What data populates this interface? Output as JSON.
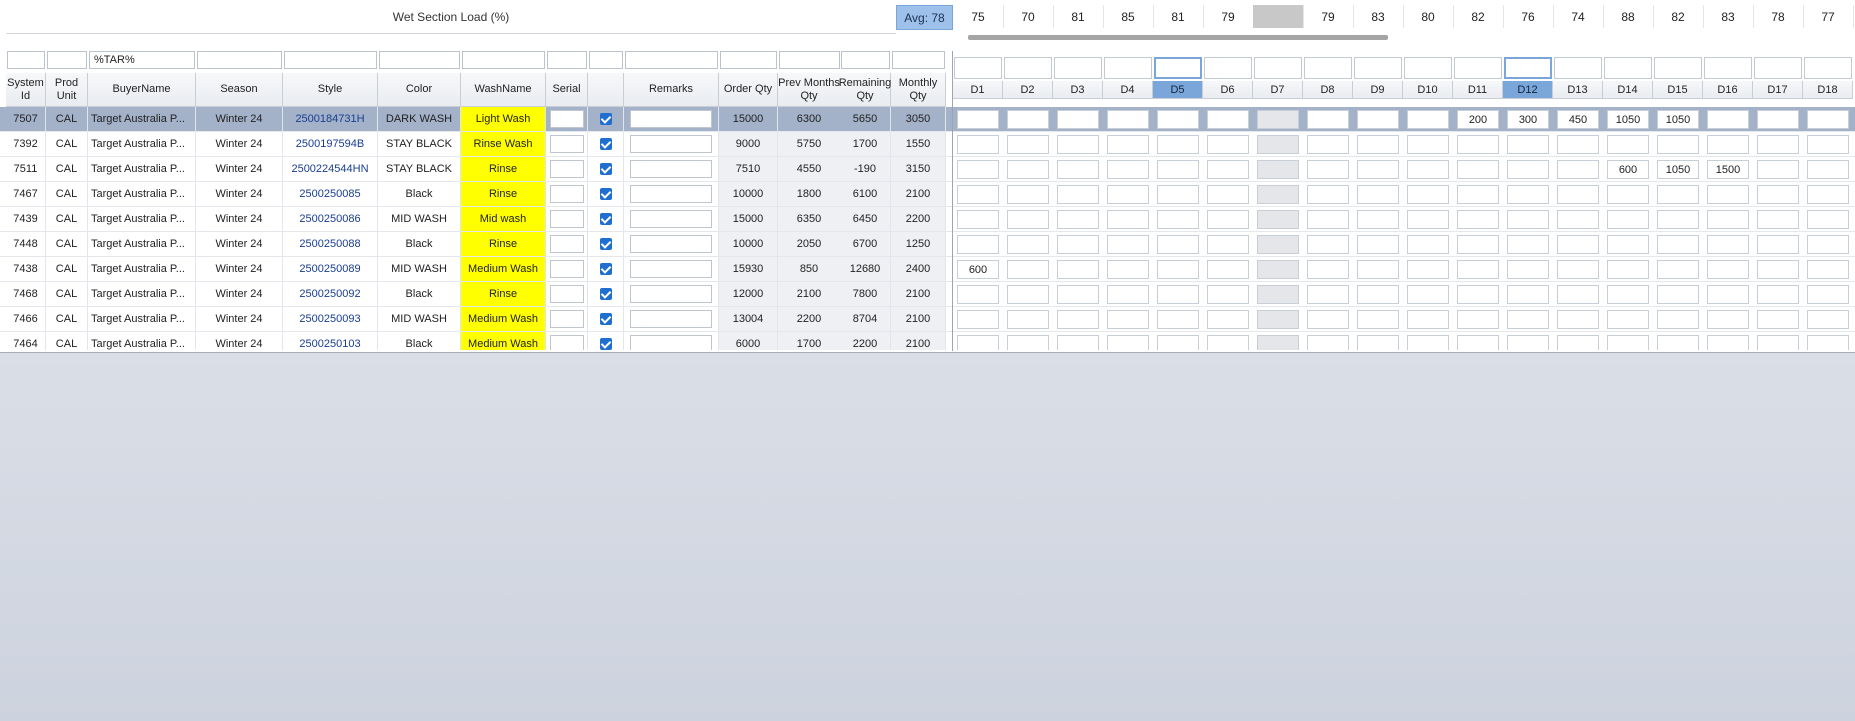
{
  "load": {
    "label": "Wet Section Load (%)",
    "avg": "Avg: 78",
    "values": [
      "75",
      "70",
      "81",
      "85",
      "81",
      "79",
      "",
      "79",
      "83",
      "80",
      "82",
      "76",
      "74",
      "88",
      "82",
      "83",
      "78",
      "77"
    ]
  },
  "filters": {
    "system_id": "",
    "prod_unit": "",
    "buyer": "%TAR%",
    "season": "",
    "style": "",
    "color": "",
    "wash": "",
    "serial": "",
    "check": "",
    "remarks": "",
    "order": "",
    "prev": "",
    "remaining": "",
    "monthly": ""
  },
  "columns": {
    "system_id": "System Id",
    "prod_unit": "Prod Unit",
    "buyer": "BuyerName",
    "season": "Season",
    "style": "Style",
    "color": "Color",
    "wash": "WashName",
    "serial": "Serial",
    "check": "",
    "remarks": "Remarks",
    "order": "Order Qty",
    "prev": "Prev Months Qty",
    "remaining": "Remaining Qty",
    "monthly": "Monthly Qty"
  },
  "days": [
    "D1",
    "D2",
    "D3",
    "D4",
    "D5",
    "D6",
    "D7",
    "D8",
    "D9",
    "D10",
    "D11",
    "D12",
    "D13",
    "D14",
    "D15",
    "D16",
    "D17",
    "D18"
  ],
  "rows": [
    {
      "id": "7507",
      "unit": "CAL",
      "buyer": "Target Australia P...",
      "season": "Winter 24",
      "style": "2500184731H",
      "color": "DARK WASH",
      "wash": "Light Wash",
      "order": "15000",
      "prev": "6300",
      "remaining": "5650",
      "monthly": "3050",
      "d": [
        "",
        "",
        "",
        "",
        "",
        "",
        "",
        "",
        "",
        "",
        "200",
        "300",
        "450",
        "1050",
        "1050",
        "",
        "",
        ""
      ]
    },
    {
      "id": "7392",
      "unit": "CAL",
      "buyer": "Target Australia P...",
      "season": "Winter 24",
      "style": "2500197594B",
      "color": "STAY BLACK",
      "wash": "Rinse Wash",
      "order": "9000",
      "prev": "5750",
      "remaining": "1700",
      "monthly": "1550",
      "d": [
        "",
        "",
        "",
        "",
        "",
        "",
        "",
        "",
        "",
        "",
        "",
        "",
        "",
        "",
        "",
        "",
        "",
        ""
      ]
    },
    {
      "id": "7511",
      "unit": "CAL",
      "buyer": "Target Australia P...",
      "season": "Winter 24",
      "style": "2500224544HN",
      "color": "STAY BLACK",
      "wash": "Rinse",
      "order": "7510",
      "prev": "4550",
      "remaining": "-190",
      "monthly": "3150",
      "d": [
        "",
        "",
        "",
        "",
        "",
        "",
        "",
        "",
        "",
        "",
        "",
        "",
        "",
        "600",
        "1050",
        "1500",
        "",
        ""
      ]
    },
    {
      "id": "7467",
      "unit": "CAL",
      "buyer": "Target Australia P...",
      "season": "Winter 24",
      "style": "2500250085",
      "color": "Black",
      "wash": "Rinse",
      "order": "10000",
      "prev": "1800",
      "remaining": "6100",
      "monthly": "2100",
      "d": [
        "",
        "",
        "",
        "",
        "",
        "",
        "",
        "",
        "",
        "",
        "",
        "",
        "",
        "",
        "",
        "",
        "",
        ""
      ]
    },
    {
      "id": "7439",
      "unit": "CAL",
      "buyer": "Target Australia P...",
      "season": "Winter 24",
      "style": "2500250086",
      "color": "MID WASH",
      "wash": "Mid wash",
      "order": "15000",
      "prev": "6350",
      "remaining": "6450",
      "monthly": "2200",
      "d": [
        "",
        "",
        "",
        "",
        "",
        "",
        "",
        "",
        "",
        "",
        "",
        "",
        "",
        "",
        "",
        "",
        "",
        ""
      ]
    },
    {
      "id": "7448",
      "unit": "CAL",
      "buyer": "Target Australia P...",
      "season": "Winter 24",
      "style": "2500250088",
      "color": "Black",
      "wash": "Rinse",
      "order": "10000",
      "prev": "2050",
      "remaining": "6700",
      "monthly": "1250",
      "d": [
        "",
        "",
        "",
        "",
        "",
        "",
        "",
        "",
        "",
        "",
        "",
        "",
        "",
        "",
        "",
        "",
        "",
        ""
      ]
    },
    {
      "id": "7438",
      "unit": "CAL",
      "buyer": "Target Australia P...",
      "season": "Winter 24",
      "style": "2500250089",
      "color": "MID WASH",
      "wash": "Medium Wash",
      "order": "15930",
      "prev": "850",
      "remaining": "12680",
      "monthly": "2400",
      "d": [
        "600",
        "",
        "",
        "",
        "",
        "",
        "",
        "",
        "",
        "",
        "",
        "",
        "",
        "",
        "",
        "",
        "",
        ""
      ]
    },
    {
      "id": "7468",
      "unit": "CAL",
      "buyer": "Target Australia P...",
      "season": "Winter 24",
      "style": "2500250092",
      "color": "Black",
      "wash": "Rinse",
      "order": "12000",
      "prev": "2100",
      "remaining": "7800",
      "monthly": "2100",
      "d": [
        "",
        "",
        "",
        "",
        "",
        "",
        "",
        "",
        "",
        "",
        "",
        "",
        "",
        "",
        "",
        "",
        "",
        ""
      ]
    },
    {
      "id": "7466",
      "unit": "CAL",
      "buyer": "Target Australia P...",
      "season": "Winter 24",
      "style": "2500250093",
      "color": "MID WASH",
      "wash": "Medium Wash",
      "order": "13004",
      "prev": "2200",
      "remaining": "8704",
      "monthly": "2100",
      "d": [
        "",
        "",
        "",
        "",
        "",
        "",
        "",
        "",
        "",
        "",
        "",
        "",
        "",
        "",
        "",
        "",
        "",
        ""
      ]
    },
    {
      "id": "7464",
      "unit": "CAL",
      "buyer": "Target Australia P...",
      "season": "Winter 24",
      "style": "2500250103",
      "color": "Black",
      "wash": "Medium Wash",
      "order": "6000",
      "prev": "1700",
      "remaining": "2200",
      "monthly": "2100",
      "d": [
        "",
        "",
        "",
        "",
        "",
        "",
        "",
        "",
        "",
        "",
        "",
        "",
        "",
        "",
        "",
        "",
        "",
        ""
      ]
    }
  ]
}
